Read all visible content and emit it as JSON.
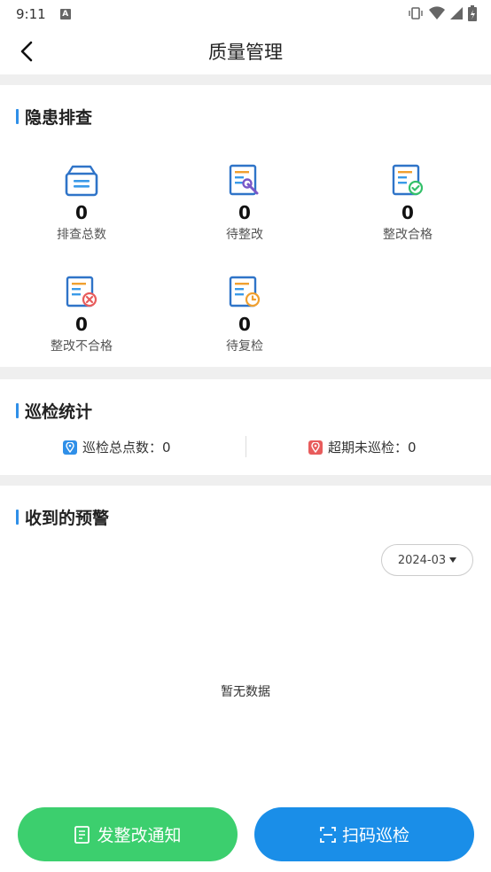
{
  "status_bar": {
    "time": "9:11",
    "indicator": "A"
  },
  "header": {
    "title": "质量管理"
  },
  "hazard": {
    "title": "隐患排查",
    "items": [
      {
        "value": "0",
        "label": "排查总数",
        "icon": "inbox-icon"
      },
      {
        "value": "0",
        "label": "待整改",
        "icon": "document-wrench-icon"
      },
      {
        "value": "0",
        "label": "整改合格",
        "icon": "document-check-icon"
      },
      {
        "value": "0",
        "label": "整改不合格",
        "icon": "document-cross-icon"
      },
      {
        "value": "0",
        "label": "待复检",
        "icon": "document-clock-icon"
      }
    ]
  },
  "inspection": {
    "title": "巡检统计",
    "total_text": "巡检总点数：0",
    "overdue_text": "超期未巡检：0"
  },
  "warnings": {
    "title": "收到的预警",
    "date": "2024-03",
    "empty_text": "暂无数据"
  },
  "buttons": {
    "notice": "发整改通知",
    "scan": "扫码巡检"
  },
  "colors": {
    "accent": "#2f8fe8",
    "green": "#3ccf6e",
    "blue": "#1a8ee8",
    "orange": "#f0a030",
    "red": "#e85c5c"
  }
}
